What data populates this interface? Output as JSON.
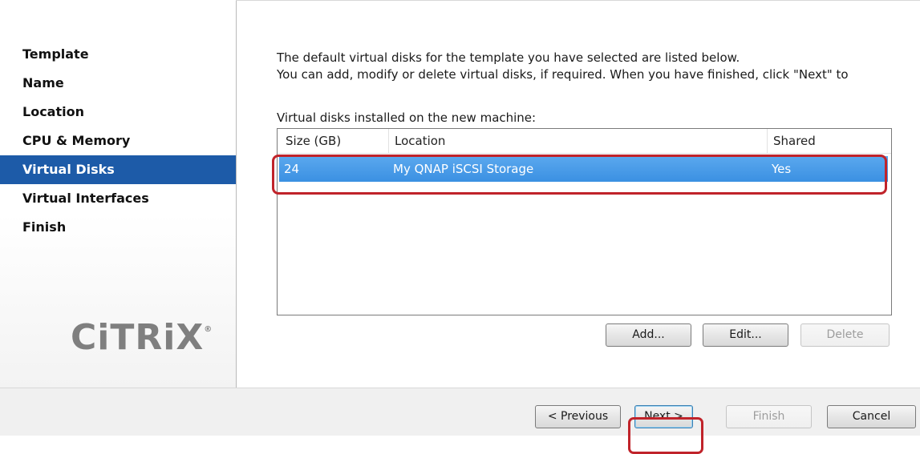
{
  "sidebar": {
    "steps": [
      {
        "label": "Template"
      },
      {
        "label": "Name"
      },
      {
        "label": "Location"
      },
      {
        "label": "CPU & Memory"
      },
      {
        "label": "Virtual Disks",
        "active": true
      },
      {
        "label": "Virtual Interfaces"
      },
      {
        "label": "Finish"
      }
    ],
    "logo_text": "CiTRiX",
    "logo_mark": "®"
  },
  "main": {
    "intro_line1": "The default virtual disks for the template you have selected are listed below.",
    "intro_line2": "You can add, modify or delete virtual disks, if required. When you have finished, click \"Next\" to",
    "list_caption": "Virtual disks installed on the new machine:",
    "columns": [
      "Size (GB)",
      "Location",
      "Shared"
    ],
    "rows": [
      {
        "size": "24",
        "location": "My QNAP iSCSI Storage",
        "shared": "Yes",
        "selected": true
      }
    ]
  },
  "disk_buttons": {
    "add": "Add...",
    "edit": "Edit...",
    "delete": "Delete"
  },
  "footer": {
    "previous": "< Previous",
    "next": "Next >",
    "finish": "Finish",
    "cancel": "Cancel"
  },
  "colors": {
    "selection": "#3b90e2",
    "active_step": "#1d5ba8",
    "highlight": "#c0232a"
  }
}
